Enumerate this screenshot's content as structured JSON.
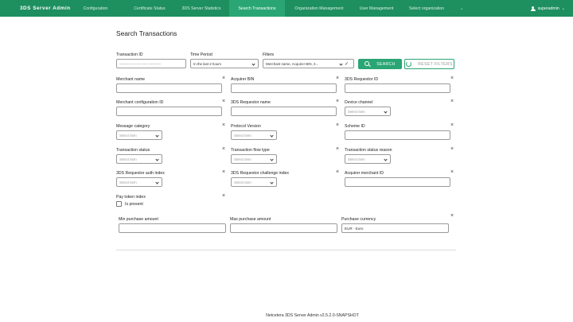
{
  "brand": "3DS Server Admin",
  "nav": {
    "items": [
      {
        "label": "Configuration",
        "active": false
      },
      {
        "label": "Certificate Status",
        "active": false
      },
      {
        "label": "3DS Server Statistics",
        "active": false
      },
      {
        "label": "Search Transactions",
        "active": true
      },
      {
        "label": "Organization Management",
        "active": false
      },
      {
        "label": "User Management",
        "active": false
      }
    ],
    "org_select": "Select organization",
    "user": "superadmin"
  },
  "page": {
    "title": "Search Transactions"
  },
  "filters": {
    "transaction_id_label": "Transaction ID",
    "transaction_id_placeholder": "--------·----·----·----·----------",
    "time_period_label": "Time Period",
    "time_period_value": "In the last 2 hours",
    "filters_label": "Filters",
    "filters_value": "Merchant name, Acquirer BIN, 3...",
    "search_button": "SEARCH",
    "reset_button": "RESET FILTERS"
  },
  "fields": {
    "merchant_name": "Merchant name",
    "acquirer_bin": "Acquirer BIN",
    "requestor_id": "3DS Requestor ID",
    "merchant_config_id": "Merchant configuration ID",
    "requestor_name": "3DS Requestor name",
    "device_channel": "Device channel",
    "message_category": "Message category",
    "protocol_version": "Protocol Version",
    "scheme_id": "Scheme ID",
    "transaction_status": "Transaction status",
    "transaction_flow_type": "Transaction flow type",
    "transaction_status_reason": "Transaction status reason",
    "requestor_auth_index": "3DS Requestor auth index",
    "requestor_challenge_index": "3DS Requestor challenge index",
    "acquirer_merchant_id": "Acquirer merchant ID",
    "pay_token_index": "Pay token index",
    "is_present": "Is present",
    "min_purchase_amount": "Min purchase amount",
    "max_purchase_amount": "Max purchase amount",
    "purchase_currency": "Purchase currency",
    "purchase_currency_value": "EUR - Euro",
    "select_item": "Select item"
  },
  "footer": "Netcetera 3DS Server Admin v2.5.2.0-SNAPSHOT",
  "colors": {
    "topbar": "#1e8f5f",
    "active_tab": "#2aa674",
    "accent": "#2aa674"
  }
}
